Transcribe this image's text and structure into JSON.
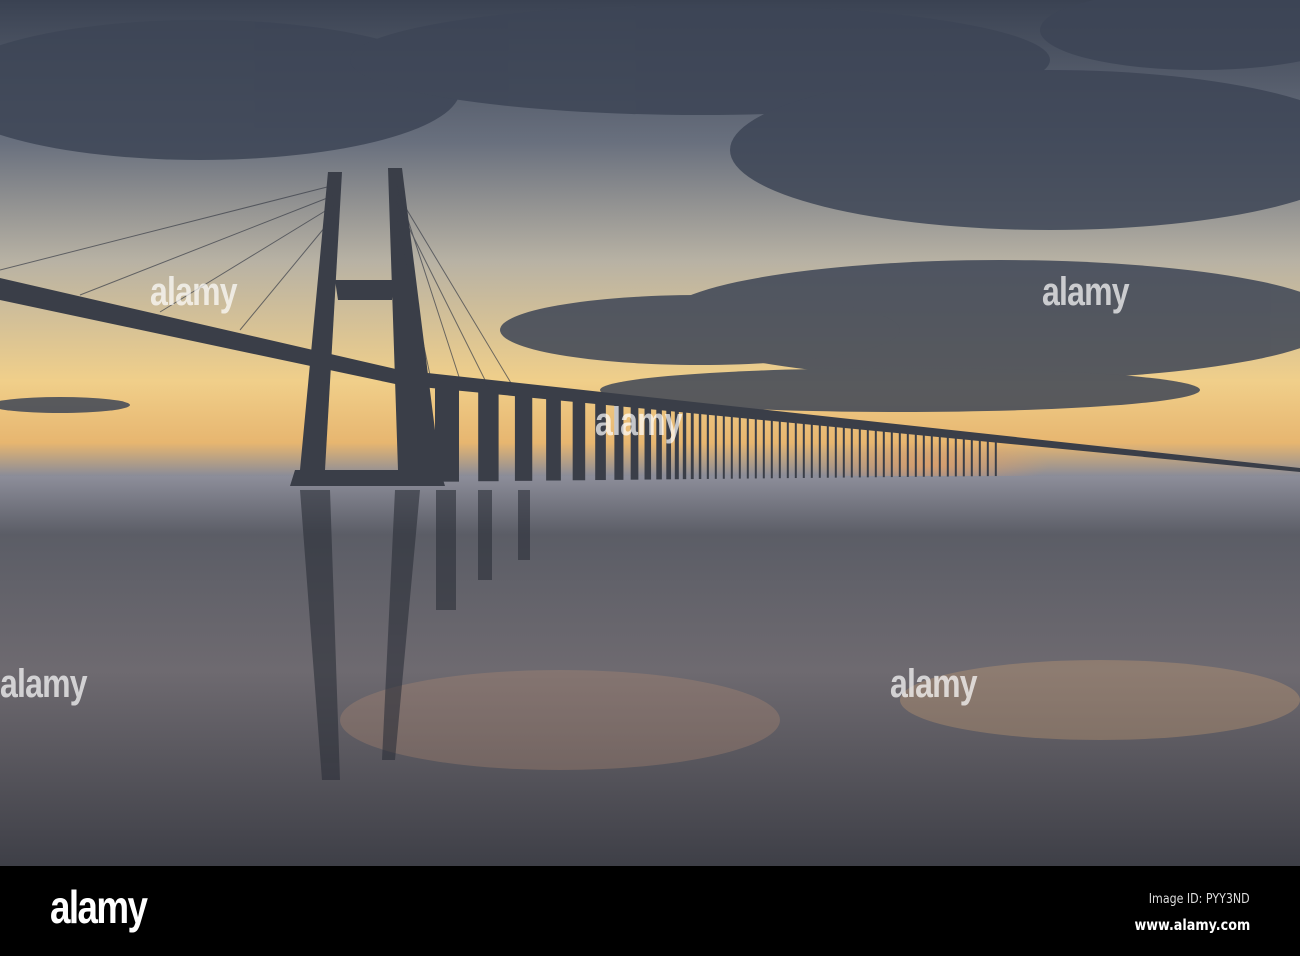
{
  "footer": {
    "logo": "alamy",
    "image_id": "Image ID: PYY3ND",
    "website": "www.alamy.com"
  },
  "watermark": "alamy",
  "colors": {
    "sky_top": "#3b4352",
    "horizon_glow": "#f2c46a",
    "water": "#5a5a66"
  }
}
